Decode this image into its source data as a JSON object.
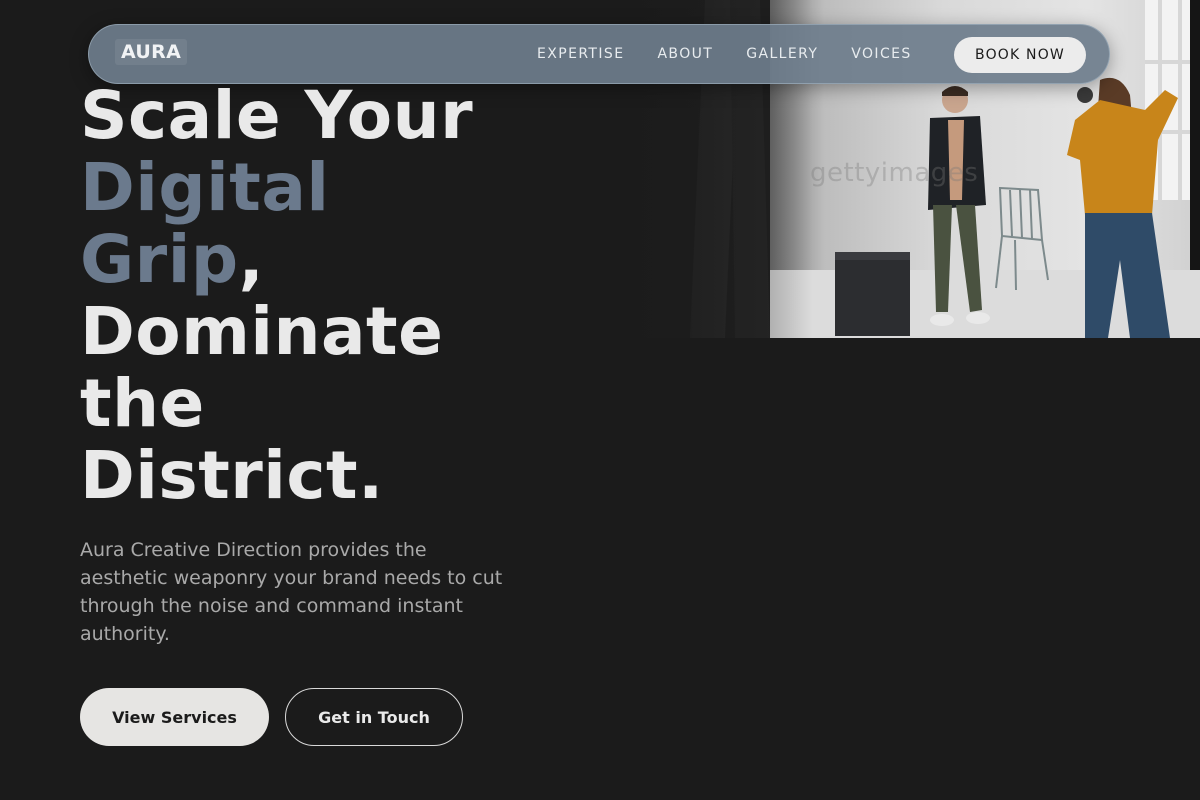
{
  "nav": {
    "logo": "AURA",
    "links": [
      "EXPERTISE",
      "ABOUT",
      "GALLERY",
      "VOICES"
    ],
    "cta": "BOOK NOW"
  },
  "hero": {
    "headline": {
      "line1": "Scale Your",
      "line2": "Digital",
      "line3_accent": "Grip",
      "line3_rest": ",",
      "line4": "Dominate",
      "line5": "the",
      "line6": "District."
    },
    "description": "Aura Creative Direction provides the aesthetic weaponry your brand needs to cut through the noise and command instant authority.",
    "primary_button": "View Services",
    "secondary_button": "Get in Touch",
    "photo_watermark": "gettyimages"
  },
  "colors": {
    "background": "#1b1b1b",
    "accent": "#6b7a8d",
    "nav_bg": "#6e7d8c",
    "text_primary": "#e9e9e9",
    "text_muted": "#a9a9a9"
  }
}
